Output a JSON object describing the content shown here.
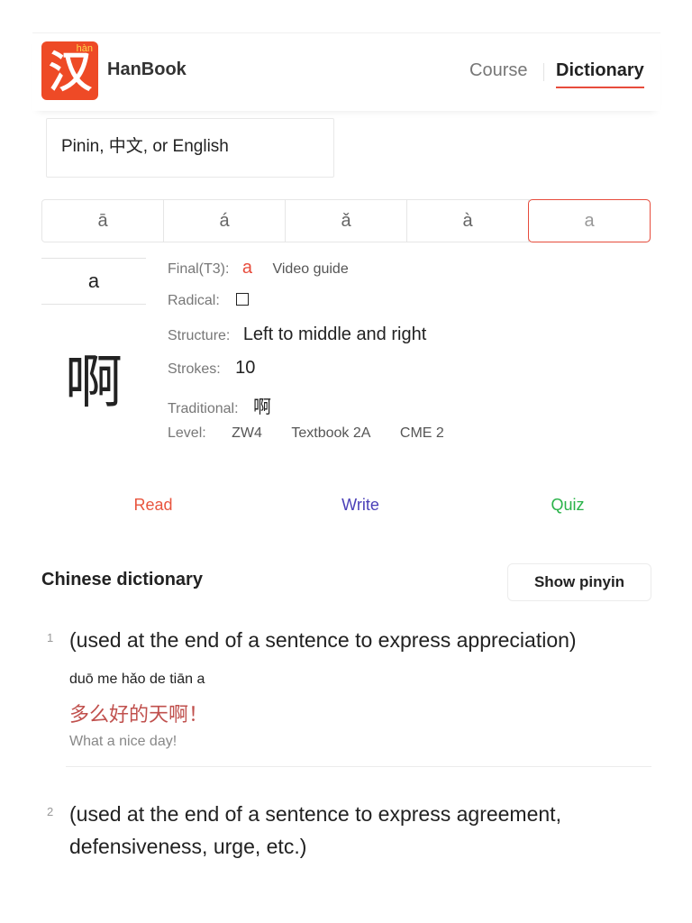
{
  "header": {
    "logo_hanzi": "汉",
    "logo_pinyin": "hàn",
    "app_name": "HanBook",
    "nav": {
      "course": "Course",
      "dictionary": "Dictionary"
    }
  },
  "search": {
    "placeholder": "Pinin, 中文, or English"
  },
  "tones": [
    "ā",
    "á",
    "ǎ",
    "à",
    "a"
  ],
  "char": {
    "pinyin": "a",
    "hanzi": "啊",
    "final_label": "Final(T3):",
    "final_value": "a",
    "video_guide": "Video guide",
    "radical_label": "Radical:",
    "structure_label": "Structure:",
    "structure_value": "Left to middle and right",
    "strokes_label": "Strokes:",
    "strokes_value": "10",
    "traditional_label": "Traditional:",
    "traditional_value": "啊",
    "level_label": "Level:",
    "levels": [
      "ZW4",
      "Textbook 2A",
      "CME 2"
    ]
  },
  "actions": {
    "read": "Read",
    "write": "Write",
    "quiz": "Quiz"
  },
  "dictionary": {
    "title": "Chinese dictionary",
    "show_pinyin": "Show pinyin",
    "definitions": [
      {
        "num": "1",
        "text": "(used at the end of a sentence to express appreciation)",
        "ex_pinyin": "duō me hǎo de tiān a",
        "ex_hanzi": "多么好的天啊！",
        "ex_en": "What a nice day!"
      },
      {
        "num": "2",
        "text_line1": "(used at the end of a sentence to express agreement,",
        "text_line2": "defensiveness, urge, etc.)"
      }
    ]
  },
  "colors": {
    "accent": "#e74c3c",
    "logo_bg": "#ee4a26",
    "read": "#e8553e",
    "write": "#4a3fb8",
    "quiz": "#2ab34a",
    "example": "#c0504d"
  }
}
